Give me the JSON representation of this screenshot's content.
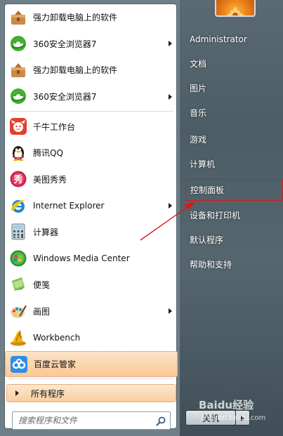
{
  "programs": [
    {
      "label": "强力卸载电脑上的软件",
      "icon": "uninstall-box-icon",
      "arrow": false
    },
    {
      "label": "360安全浏览器7",
      "icon": "360-browser-icon",
      "arrow": true
    },
    {
      "label": "强力卸载电脑上的软件",
      "icon": "uninstall-box-icon",
      "arrow": false
    },
    {
      "label": "360安全浏览器7",
      "icon": "360-browser-icon",
      "arrow": true
    },
    {
      "label": "千牛工作台",
      "icon": "qianniu-icon",
      "arrow": false
    },
    {
      "label": "腾讯QQ",
      "icon": "qq-penguin-icon",
      "arrow": false
    },
    {
      "label": "美图秀秀",
      "icon": "meitu-icon",
      "arrow": false
    },
    {
      "label": "Internet Explorer",
      "icon": "internet-explorer-icon",
      "arrow": true
    },
    {
      "label": "计算器",
      "icon": "calculator-icon",
      "arrow": false
    },
    {
      "label": "Windows Media Center",
      "icon": "windows-media-center-icon",
      "arrow": false
    },
    {
      "label": "便笺",
      "icon": "sticky-notes-icon",
      "arrow": false
    },
    {
      "label": "画图",
      "icon": "paint-icon",
      "arrow": true
    },
    {
      "label": "Workbench",
      "icon": "workbench-icon",
      "arrow": false
    },
    {
      "label": "百度云管家",
      "icon": "baidu-cloud-icon",
      "arrow": false
    }
  ],
  "all_programs": "所有程序",
  "search": {
    "placeholder": "搜索程序和文件"
  },
  "right_menu": [
    {
      "label": "Administrator"
    },
    {
      "label": "文档"
    },
    {
      "label": "图片"
    },
    {
      "label": "音乐"
    },
    {
      "label": "游戏"
    },
    {
      "label": "计算机"
    },
    {
      "label": "控制面板"
    },
    {
      "label": "设备和打印机"
    },
    {
      "label": "默认程序"
    },
    {
      "label": "帮助和支持"
    }
  ],
  "shutdown": {
    "label": "关机"
  },
  "watermark": {
    "brand": "Baidu经验",
    "url": "jingyan.baidu.com"
  },
  "colors": {
    "highlight_border": "#d81919",
    "arrow": "#d81919",
    "selected_bg": "#f8c994"
  }
}
